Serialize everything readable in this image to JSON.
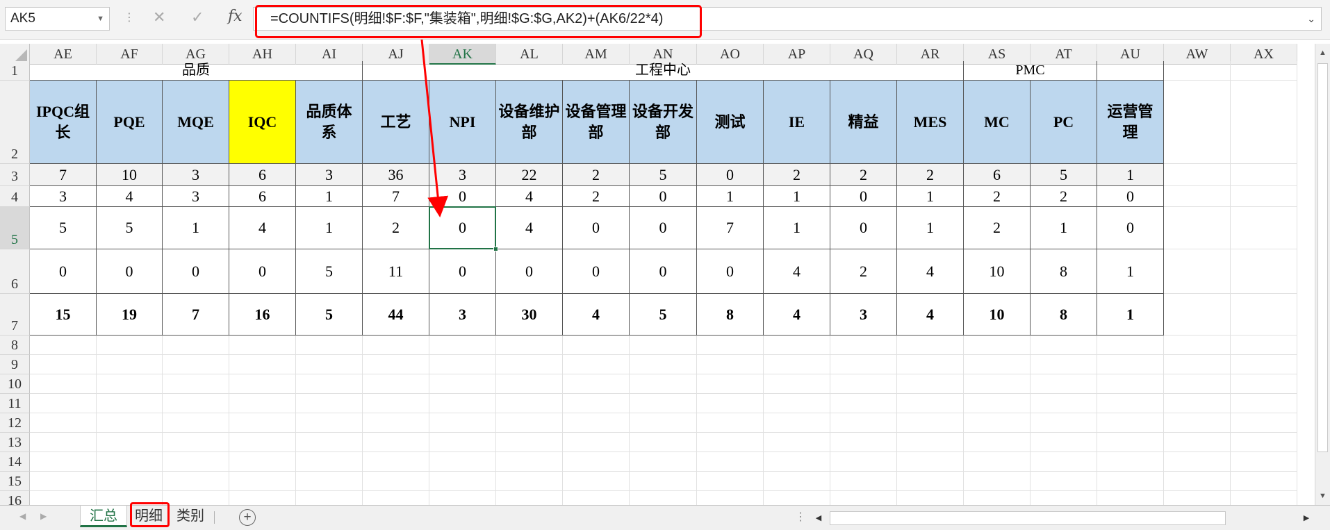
{
  "name_box": {
    "value": "AK5"
  },
  "formula": {
    "text": "=COUNTIFS(明细!$F:$F,\"集装箱\",明细!$G:$G,AK2)+(AK6/22*4)"
  },
  "toolbar_icons": {
    "cancel": "✕",
    "enter": "✓",
    "fx": "fx"
  },
  "columns": [
    "AE",
    "AF",
    "AG",
    "AH",
    "AI",
    "AJ",
    "AK",
    "AL",
    "AM",
    "AN",
    "AO",
    "AP",
    "AQ",
    "AR",
    "AS",
    "AT",
    "AU",
    "AW",
    "AX"
  ],
  "active_column": "AK",
  "rows": [
    "1",
    "2",
    "3",
    "4",
    "5",
    "6",
    "7",
    "8",
    "9",
    "10",
    "11",
    "12",
    "13",
    "14",
    "15",
    "16"
  ],
  "active_row": "5",
  "groups": {
    "quality": "品质",
    "engineering": "工程中心",
    "pmc": "PMC"
  },
  "headers": [
    "IPQC组长",
    "PQE",
    "MQE",
    "IQC",
    "品质体系",
    "工艺",
    "NPI",
    "设备维护部",
    "设备管理部",
    "设备开发部",
    "测试",
    "IE",
    "精益",
    "MES",
    "MC",
    "PC",
    "运营管理"
  ],
  "table": {
    "row3": [
      "7",
      "10",
      "3",
      "6",
      "3",
      "36",
      "3",
      "22",
      "2",
      "5",
      "0",
      "2",
      "2",
      "2",
      "6",
      "5",
      "1"
    ],
    "row4": [
      "3",
      "4",
      "3",
      "6",
      "1",
      "7",
      "0",
      "4",
      "2",
      "0",
      "1",
      "1",
      "0",
      "1",
      "2",
      "2",
      "0"
    ],
    "row5": [
      "5",
      "5",
      "1",
      "4",
      "1",
      "2",
      "0",
      "4",
      "0",
      "0",
      "7",
      "1",
      "0",
      "1",
      "2",
      "1",
      "0"
    ],
    "row6": [
      "0",
      "0",
      "0",
      "0",
      "5",
      "11",
      "0",
      "0",
      "0",
      "0",
      "0",
      "4",
      "2",
      "4",
      "10",
      "8",
      "1"
    ],
    "row7": [
      "15",
      "19",
      "7",
      "16",
      "5",
      "44",
      "3",
      "30",
      "4",
      "5",
      "8",
      "4",
      "3",
      "4",
      "10",
      "8",
      "1"
    ]
  },
  "sheet_tabs": [
    "汇总",
    "明细",
    "类别"
  ],
  "active_sheet": "汇总",
  "colors": {
    "header_fill": "#bdd7ee",
    "highlight_fill": "#ffff00",
    "accent": "#217346",
    "annotation": "#ff0000"
  }
}
